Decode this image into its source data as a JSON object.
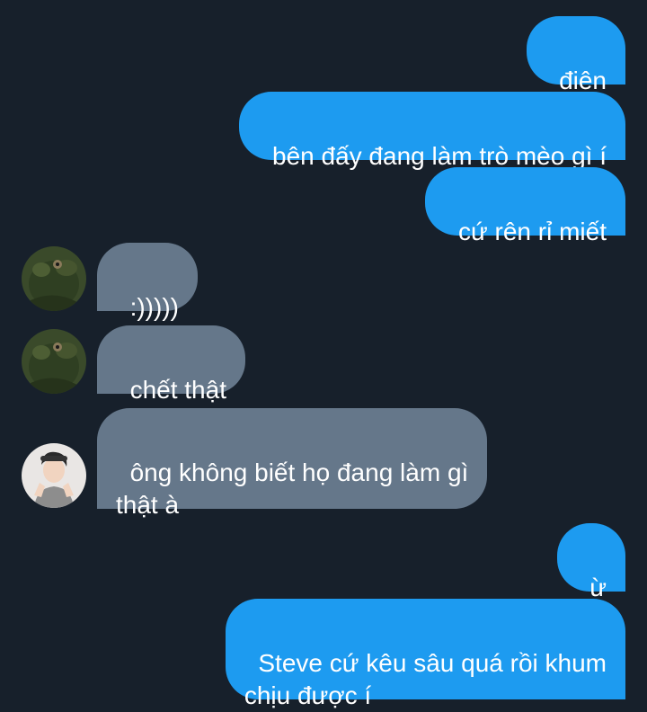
{
  "messages": [
    {
      "sender": "me",
      "text": "điên"
    },
    {
      "sender": "me",
      "text": "bên đấy đang làm trò mèo gì í"
    },
    {
      "sender": "me",
      "text": "cứ rên rỉ miết"
    },
    {
      "sender": "them",
      "avatar": "green-creature-avatar",
      "text": ":)))))"
    },
    {
      "sender": "them",
      "avatar": "green-creature-avatar",
      "text": "chết thật"
    },
    {
      "sender": "them",
      "avatar": "person-avatar",
      "text": "ông không biết họ đang làm gì\nthật à"
    },
    {
      "sender": "me",
      "text": "ừ"
    },
    {
      "sender": "me",
      "text": "Steve cứ kêu sâu quá rồi khum\nchịu được í"
    }
  ],
  "colors": {
    "background": "#17202b",
    "outgoing_bubble": "#1d9bf0",
    "incoming_bubble": "#65778a",
    "text": "#ffffff"
  }
}
